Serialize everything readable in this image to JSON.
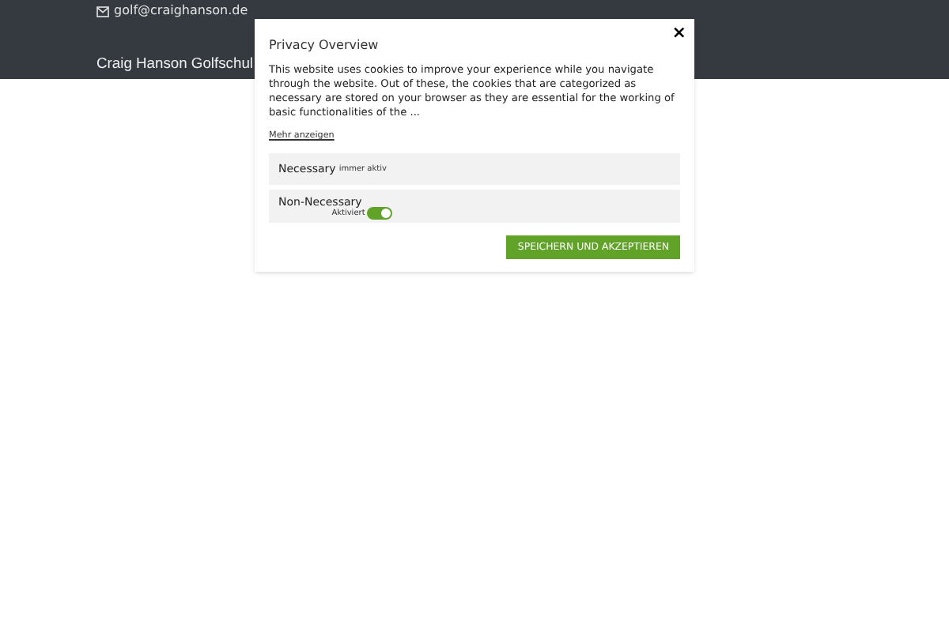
{
  "header": {
    "email": "golf@craighanson.de",
    "site_title": "Craig Hanson Golfschul"
  },
  "modal": {
    "title": "Privacy Overview",
    "close": "×",
    "text": "This website uses cookies to improve your experience while you navigate through the website. Out of these, the cookies that are categorized as necessary are stored on your browser as they are essential for the working of basic functionalities of the ...",
    "more_link": "Mehr anzeigen",
    "categories": [
      {
        "kind": "fixed",
        "name": "Necessary",
        "note": "immer aktiv"
      },
      {
        "kind": "toggle",
        "name": "Non-Necessary",
        "note": "Aktiviert",
        "on": true
      }
    ],
    "button": "SPEICHERN UND AKZEPTIEREN"
  }
}
